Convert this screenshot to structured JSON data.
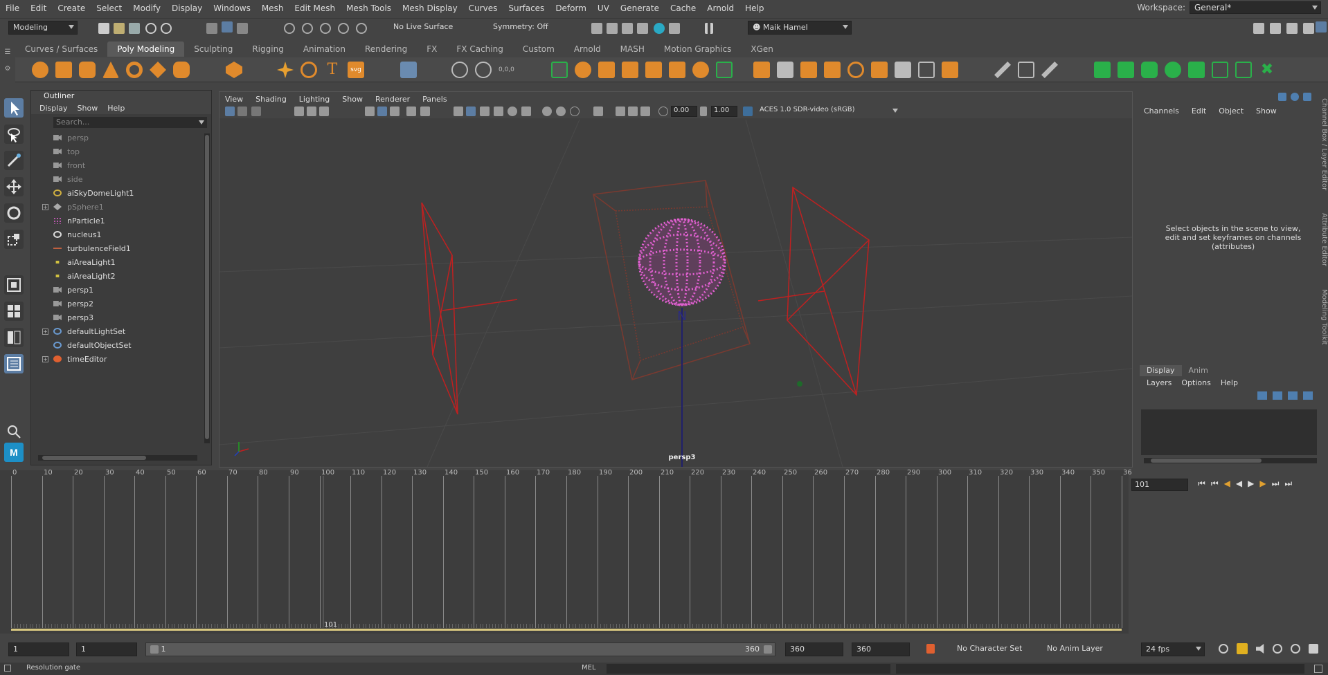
{
  "menubar": {
    "items": [
      "File",
      "Edit",
      "Create",
      "Select",
      "Modify",
      "Display",
      "Windows",
      "Mesh",
      "Edit Mesh",
      "Mesh Tools",
      "Mesh Display",
      "Curves",
      "Surfaces",
      "Deform",
      "UV",
      "Generate",
      "Cache",
      "Arnold",
      "Help"
    ],
    "workspace_label": "Workspace:",
    "workspace_value": "General*"
  },
  "statusline": {
    "mode": "Modeling",
    "live_surface": "No Live Surface",
    "symmetry": "Symmetry: Off",
    "user": "Maik Hamel"
  },
  "shelf": {
    "tabs": [
      "Curves / Surfaces",
      "Poly Modeling",
      "Sculpting",
      "Rigging",
      "Animation",
      "Rendering",
      "FX",
      "FX Caching",
      "Custom",
      "Arnold",
      "MASH",
      "Motion Graphics",
      "XGen"
    ],
    "active_tab": "Poly Modeling"
  },
  "outliner": {
    "title": "Outliner",
    "menu": [
      "Display",
      "Show",
      "Help"
    ],
    "search_placeholder": "Search...",
    "items": [
      {
        "label": "persp",
        "icon": "camera-icon",
        "dim": true,
        "expandable": false
      },
      {
        "label": "top",
        "icon": "camera-icon",
        "dim": true,
        "expandable": false
      },
      {
        "label": "front",
        "icon": "camera-icon",
        "dim": true,
        "expandable": false
      },
      {
        "label": "side",
        "icon": "camera-icon",
        "dim": true,
        "expandable": false
      },
      {
        "label": "aiSkyDomeLight1",
        "icon": "skydome-icon",
        "dim": false,
        "expandable": false
      },
      {
        "label": "pSphere1",
        "icon": "mesh-icon",
        "dim": true,
        "expandable": true
      },
      {
        "label": "nParticle1",
        "icon": "particle-icon",
        "dim": false,
        "expandable": false
      },
      {
        "label": "nucleus1",
        "icon": "nucleus-icon",
        "dim": false,
        "expandable": false
      },
      {
        "label": "turbulenceField1",
        "icon": "field-icon",
        "dim": false,
        "expandable": false
      },
      {
        "label": "aiAreaLight1",
        "icon": "area-light-icon",
        "dim": false,
        "expandable": false
      },
      {
        "label": "aiAreaLight2",
        "icon": "area-light-icon",
        "dim": false,
        "expandable": false
      },
      {
        "label": "persp1",
        "icon": "camera-icon",
        "dim": false,
        "expandable": false
      },
      {
        "label": "persp2",
        "icon": "camera-icon",
        "dim": false,
        "expandable": false
      },
      {
        "label": "persp3",
        "icon": "camera-icon",
        "dim": false,
        "expandable": false
      },
      {
        "label": "defaultLightSet",
        "icon": "set-icon",
        "dim": false,
        "expandable": true
      },
      {
        "label": "defaultObjectSet",
        "icon": "set-icon",
        "dim": false,
        "expandable": false
      },
      {
        "label": "timeEditor",
        "icon": "time-editor-icon",
        "dim": false,
        "expandable": true
      }
    ]
  },
  "viewport": {
    "menu": [
      "View",
      "Shading",
      "Lighting",
      "Show",
      "Renderer",
      "Panels"
    ],
    "exposure": "0.00",
    "gamma": "1.00",
    "color_space": "ACES 1.0 SDR-video (sRGB)",
    "camera_label": "persp3"
  },
  "channel_box": {
    "menu": [
      "Channels",
      "Edit",
      "Object",
      "Show"
    ],
    "hint": "Select objects in the scene to view, edit and set keyframes on channels (attributes)",
    "side_tabs": [
      "Channel Box / Layer Editor",
      "Attribute Editor",
      "Modeling Toolkit"
    ]
  },
  "layer_editor": {
    "tabs": [
      "Display",
      "Anim"
    ],
    "active_tab": "Display",
    "menu": [
      "Layers",
      "Options",
      "Help"
    ]
  },
  "timeline": {
    "ticks": [
      "0",
      "10",
      "20",
      "30",
      "40",
      "50",
      "60",
      "70",
      "80",
      "90",
      "100",
      "110",
      "120",
      "130",
      "140",
      "150",
      "160",
      "170",
      "180",
      "190",
      "200",
      "210",
      "220",
      "230",
      "240",
      "250",
      "260",
      "270",
      "280",
      "290",
      "300",
      "310",
      "320",
      "330",
      "340",
      "350",
      "36"
    ],
    "current_frame": "101",
    "current_frame_field": "101"
  },
  "range": {
    "start": "1",
    "playback_start": "1",
    "slider_start": "1",
    "slider_end": "360",
    "playback_end": "360",
    "end": "360",
    "character_set": "No Character Set",
    "anim_layer": "No Anim Layer",
    "fps": "24 fps"
  },
  "commandline": {
    "help_text": "Resolution gate",
    "mel_label": "MEL"
  },
  "colors": {
    "accent": "#5c7da3",
    "particle": "#e060d0",
    "light_wire": "#c02020",
    "bbox": "#7a3a30",
    "timeline_range": "#d8c880"
  }
}
